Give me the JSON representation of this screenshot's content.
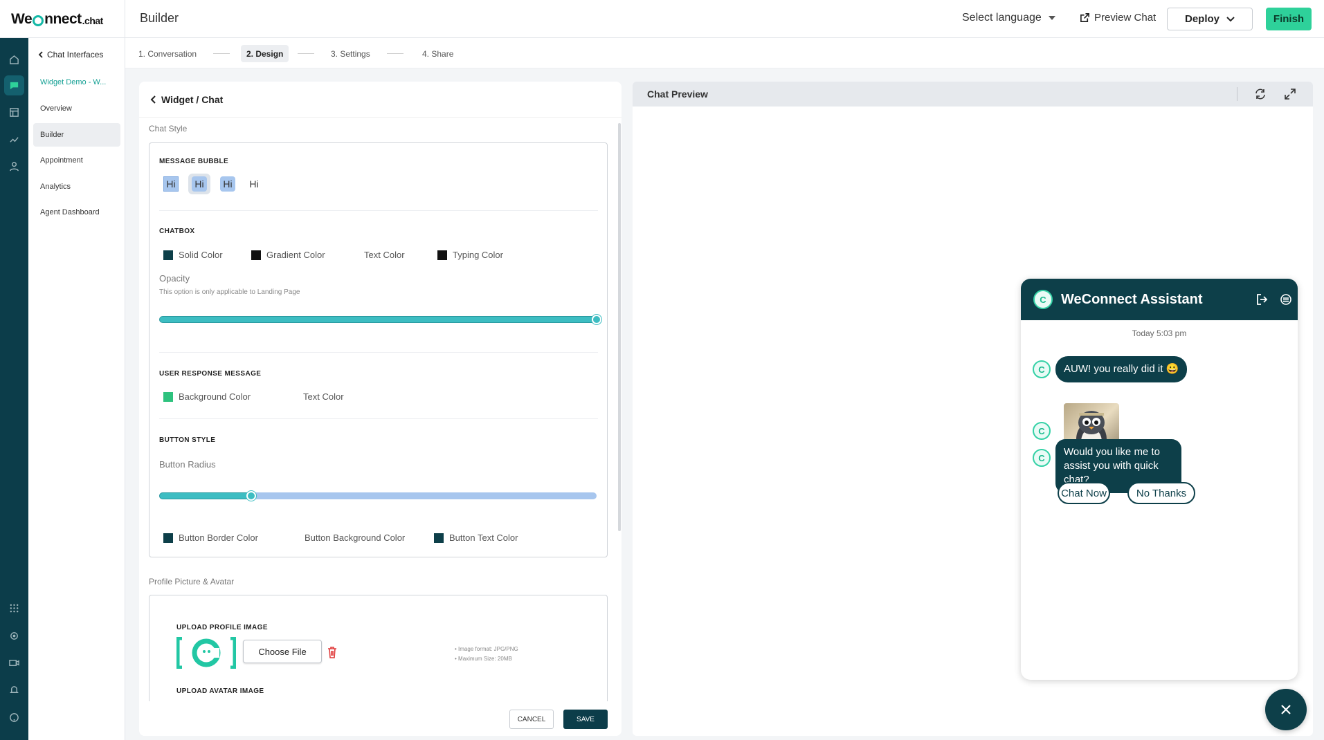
{
  "app": {
    "logo_main": "We",
    "logo_rest": "nnect",
    "logo_suffix": ".chat",
    "page_title": "Builder"
  },
  "topbar": {
    "language_label": "Select language",
    "preview_chat": "Preview Chat",
    "deploy": "Deploy",
    "finish": "Finish"
  },
  "subnav": {
    "back": "Chat Interfaces",
    "items": [
      "Widget Demo - W...",
      "Overview",
      "Builder",
      "Appointment",
      "Analytics",
      "Agent Dashboard"
    ],
    "active_index": 2
  },
  "steps": [
    "1. Conversation",
    "2. Design",
    "3. Settings",
    "4. Share"
  ],
  "active_step": 1,
  "design": {
    "breadcrumb": "Widget / Chat",
    "chat_style_label": "Chat Style",
    "message_bubble_caption": "MESSAGE BUBBLE",
    "bubble_samples": [
      "Hi",
      "Hi",
      "Hi",
      "Hi"
    ],
    "chatbox_caption": "CHATBOX",
    "chatbox_options": [
      {
        "label": "Solid Color",
        "color": "#0d3f49"
      },
      {
        "label": "Gradient Color",
        "color": "#111111"
      },
      {
        "label": "Text Color",
        "color": "#ffffff"
      },
      {
        "label": "Typing Color",
        "color": "#111111"
      }
    ],
    "opacity_label": "Opacity",
    "opacity_note": "This option is only applicable to Landing Page",
    "opacity_value": 1.0,
    "user_response_caption": "USER RESPONSE MESSAGE",
    "user_response_options": [
      {
        "label": "Background Color",
        "color": "#2ec27e"
      },
      {
        "label": "Text Color",
        "color": "#ffffff"
      }
    ],
    "button_style_caption": "BUTTON STYLE",
    "button_radius_label": "Button Radius",
    "button_radius_value": 0.21,
    "button_options": [
      {
        "label": "Button Border Color",
        "color": "#0d3f49"
      },
      {
        "label": "Button Background Color",
        "color": "#ffffff"
      },
      {
        "label": "Button Text Color",
        "color": "#0d3f49"
      }
    ],
    "profile_label": "Profile Picture & Avatar",
    "upload_profile_caption": "UPLOAD PROFILE IMAGE",
    "choose_file": "Choose File",
    "hints": [
      "Image format: JPG/PNG",
      "Maximum Size: 20MB"
    ],
    "upload_avatar_caption": "UPLOAD AVATAR IMAGE",
    "cancel": "CANCEL",
    "save": "SAVE"
  },
  "preview": {
    "title": "Chat Preview",
    "widget_title": "WeConnect Assistant",
    "time": "Today 5:03 pm",
    "messages": [
      "AUW! you really did it 😀",
      "Would you like me to assist you with quick chat?"
    ],
    "chips": [
      "Chat Now",
      "No Thanks"
    ]
  },
  "colors": {
    "brand_dark": "#0d3f49",
    "accent_green": "#2ed19a",
    "teal": "#14b8a6"
  }
}
